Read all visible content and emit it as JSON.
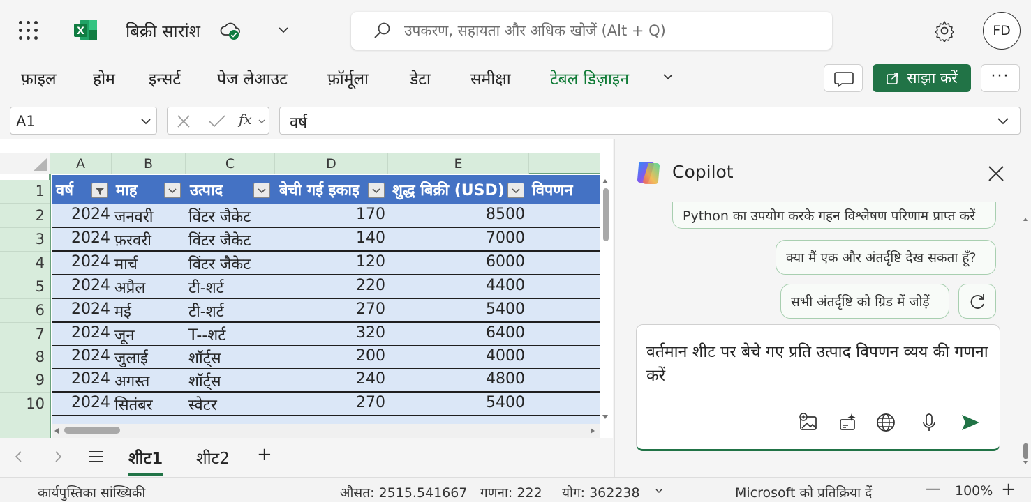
{
  "titlebar": {
    "doc_title": "बिक्री सारांश",
    "search_placeholder": "उपकरण, सहायता और अधिक खोजें (Alt + Q)",
    "avatar_initials": "FD"
  },
  "ribbon": {
    "tabs": [
      "फ़ाइल",
      "होम",
      "इन्सर्ट",
      "पेज लेआउट",
      "फ़ॉर्मूला",
      "डेटा",
      "समीक्षा",
      "टेबल डिज़ाइन"
    ],
    "active_tab": "टेबल डिज़ाइन",
    "share_label": "साझा करें",
    "more_label": "···"
  },
  "formula_bar": {
    "name_box": "A1",
    "fx_label": "fx",
    "formula": "वर्ष"
  },
  "grid": {
    "columns": [
      "A",
      "B",
      "C",
      "D",
      "E"
    ],
    "header_cells": [
      "वर्ष",
      "माह",
      "उत्पाद",
      "बेची गई इकाइ",
      "शुद्ध बिक्री (USD)",
      "विपणन"
    ],
    "row_numbers": [
      "1",
      "2",
      "3",
      "4",
      "5",
      "6",
      "7",
      "8",
      "9",
      "10"
    ],
    "rows": [
      [
        "2024",
        "जनवरी",
        "विंटर जैकेट",
        "170",
        "8500"
      ],
      [
        "2024",
        "फ़रवरी",
        "विंटर जैकेट",
        "140",
        "7000"
      ],
      [
        "2024",
        "मार्च",
        "विंटर जैकेट",
        "120",
        "6000"
      ],
      [
        "2024",
        "अप्रैल",
        "टी-शर्ट",
        "220",
        "4400"
      ],
      [
        "2024",
        "मई",
        "टी-शर्ट",
        "270",
        "5400"
      ],
      [
        "2024",
        "जून",
        "T--शर्ट",
        "320",
        "6400"
      ],
      [
        "2024",
        "जुलाई",
        "शॉर्ट्स",
        "200",
        "4000"
      ],
      [
        "2024",
        "अगस्त",
        "शॉर्ट्स",
        "240",
        "4800"
      ],
      [
        "2024",
        "सितंबर",
        "स्वेटर",
        "270",
        "5400"
      ]
    ]
  },
  "sheets": {
    "tabs": [
      "शीट1",
      "शीट2"
    ],
    "active": "शीट1",
    "add_label": "+"
  },
  "statusbar": {
    "workbook_stats": "कार्यपुस्तिका सांख्यिकी",
    "average": "औसत: 2515.541667",
    "count": "गणना: 222",
    "sum": "योग: 362238",
    "feedback": "Microsoft को प्रतिक्रिया दें",
    "zoom": "100%",
    "zoom_out": "—",
    "zoom_in": "+"
  },
  "copilot": {
    "title": "Copilot",
    "suggestions": [
      "Python का उपयोग करके गहन विश्लेषण परिणाम प्राप्त करें",
      "क्या मैं एक और अंतर्दृष्टि देख सकता हूँ?",
      "सभी अंतर्दृष्टि को ग्रिड में जोड़ें"
    ],
    "prompt": "वर्तमान शीट पर बेचे गए प्रति उत्पाद विपणन व्यय की गणना करें"
  },
  "colors": {
    "accent_green": "#217346",
    "table_header_blue": "#4472c4",
    "table_row_blue": "#dbe7f7",
    "active_tab_green": "#0e7a35"
  }
}
